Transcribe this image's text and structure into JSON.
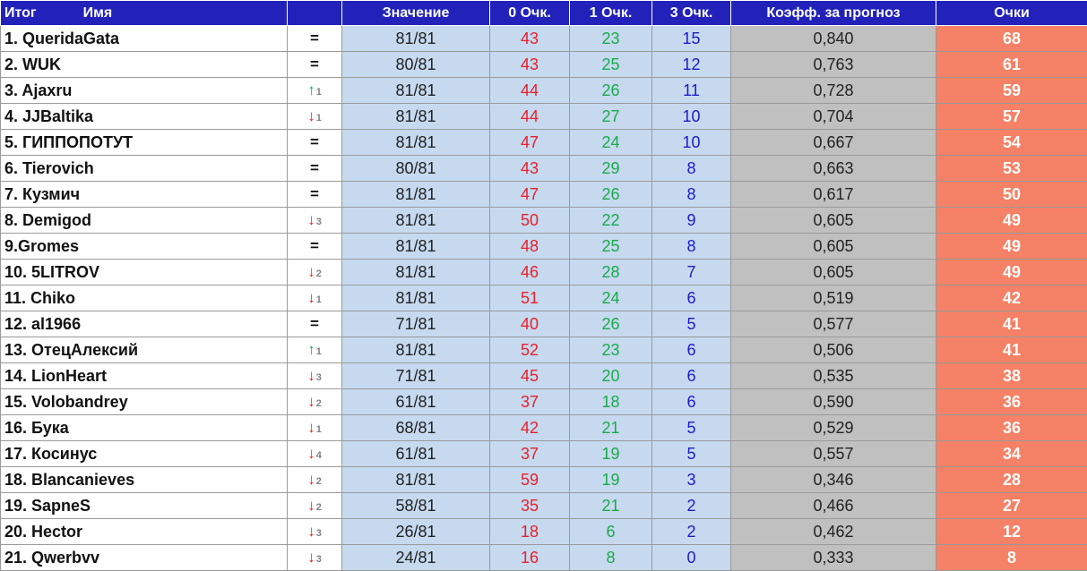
{
  "header": {
    "rank_label": "Итог",
    "name_label": "Имя",
    "value_label": "Значение",
    "p0_label": "0 Очк.",
    "p1_label": "1 Очк.",
    "p3_label": "3 Очк.",
    "coef_label": "Коэфф. за прогноз",
    "points_label": "Очки"
  },
  "colors": {
    "header_bg": "#2222bb",
    "value_bg": "#c6d9ef",
    "coef_bg": "#c0c0c0",
    "points_bg": "#f58166",
    "red": "#e8202a",
    "green": "#1aaa4a",
    "blue": "#1c1cc8"
  },
  "rows": [
    {
      "name": "1. QueridaGata",
      "trend": "same",
      "trend_text": "=",
      "shift": "",
      "value": "81/81",
      "p0": "43",
      "p1": "23",
      "p3": "15",
      "coef": "0,840",
      "points": "68"
    },
    {
      "name": "2. WUK",
      "trend": "same",
      "trend_text": "=",
      "shift": "",
      "value": "80/81",
      "p0": "43",
      "p1": "25",
      "p3": "12",
      "coef": "0,763",
      "points": "61"
    },
    {
      "name": "3. Ajaxru",
      "trend": "up",
      "trend_text": "↑",
      "shift": "1",
      "value": "81/81",
      "p0": "44",
      "p1": "26",
      "p3": "11",
      "coef": "0,728",
      "points": "59"
    },
    {
      "name": "4. JJBaltika",
      "trend": "down",
      "trend_text": "↓",
      "shift": "1",
      "value": "81/81",
      "p0": "44",
      "p1": "27",
      "p3": "10",
      "coef": "0,704",
      "points": "57"
    },
    {
      "name": "5. ГИППОПОТУТ",
      "trend": "same",
      "trend_text": "=",
      "shift": "",
      "value": "81/81",
      "p0": "47",
      "p1": "24",
      "p3": "10",
      "coef": "0,667",
      "points": "54"
    },
    {
      "name": "6. Tierovich",
      "trend": "same",
      "trend_text": "=",
      "shift": "",
      "value": "80/81",
      "p0": "43",
      "p1": "29",
      "p3": "8",
      "coef": "0,663",
      "points": "53"
    },
    {
      "name": "7. Кузмич",
      "trend": "same",
      "trend_text": "=",
      "shift": "",
      "value": "81/81",
      "p0": "47",
      "p1": "26",
      "p3": "8",
      "coef": "0,617",
      "points": "50"
    },
    {
      "name": "8. Demigod",
      "trend": "down",
      "trend_text": "↓",
      "shift": "3",
      "value": "81/81",
      "p0": "50",
      "p1": "22",
      "p3": "9",
      "coef": "0,605",
      "points": "49"
    },
    {
      "name": "9.Gromes",
      "trend": "same",
      "trend_text": "=",
      "shift": "",
      "value": "81/81",
      "p0": "48",
      "p1": "25",
      "p3": "8",
      "coef": "0,605",
      "points": "49"
    },
    {
      "name": "10. 5LITROV",
      "trend": "down",
      "trend_text": "↓",
      "shift": "2",
      "value": "81/81",
      "p0": "46",
      "p1": "28",
      "p3": "7",
      "coef": "0,605",
      "points": "49"
    },
    {
      "name": "11. Chiko",
      "trend": "down",
      "trend_text": "↓",
      "shift": "1",
      "value": "81/81",
      "p0": "51",
      "p1": "24",
      "p3": "6",
      "coef": "0,519",
      "points": "42"
    },
    {
      "name": "12. al1966",
      "trend": "same",
      "trend_text": "=",
      "shift": "",
      "value": "71/81",
      "p0": "40",
      "p1": "26",
      "p3": "5",
      "coef": "0,577",
      "points": "41"
    },
    {
      "name": "13. ОтецАлексий",
      "trend": "up",
      "trend_text": "↑",
      "shift": "1",
      "value": "81/81",
      "p0": "52",
      "p1": "23",
      "p3": "6",
      "coef": "0,506",
      "points": "41"
    },
    {
      "name": "14. LionHeart",
      "trend": "down",
      "trend_text": "↓",
      "shift": "3",
      "value": "71/81",
      "p0": "45",
      "p1": "20",
      "p3": "6",
      "coef": "0,535",
      "points": "38"
    },
    {
      "name": "15. Volobandrey",
      "trend": "down",
      "trend_text": "↓",
      "shift": "2",
      "value": "61/81",
      "p0": "37",
      "p1": "18",
      "p3": "6",
      "coef": "0,590",
      "points": "36"
    },
    {
      "name": "16. Бука",
      "trend": "down",
      "trend_text": "↓",
      "shift": "1",
      "value": "68/81",
      "p0": "42",
      "p1": "21",
      "p3": "5",
      "coef": "0,529",
      "points": "36"
    },
    {
      "name": "17. Косинус",
      "trend": "down",
      "trend_text": "↓",
      "shift": "4",
      "value": "61/81",
      "p0": "37",
      "p1": "19",
      "p3": "5",
      "coef": "0,557",
      "points": "34"
    },
    {
      "name": "18. Blancanieves",
      "trend": "down",
      "trend_text": "↓",
      "shift": "2",
      "value": "81/81",
      "p0": "59",
      "p1": "19",
      "p3": "3",
      "coef": "0,346",
      "points": "28"
    },
    {
      "name": "19. SapneS",
      "trend": "down",
      "trend_text": "↓",
      "shift": "2",
      "value": "58/81",
      "p0": "35",
      "p1": "21",
      "p3": "2",
      "coef": "0,466",
      "points": "27"
    },
    {
      "name": "20. Hector",
      "trend": "down",
      "trend_text": "↓",
      "shift": "3",
      "value": "26/81",
      "p0": "18",
      "p1": "6",
      "p3": "2",
      "coef": "0,462",
      "points": "12"
    },
    {
      "name": "21. Qwerbvv",
      "trend": "down",
      "trend_text": "↓",
      "shift": "3",
      "value": "24/81",
      "p0": "16",
      "p1": "8",
      "p3": "0",
      "coef": "0,333",
      "points": "8"
    }
  ]
}
